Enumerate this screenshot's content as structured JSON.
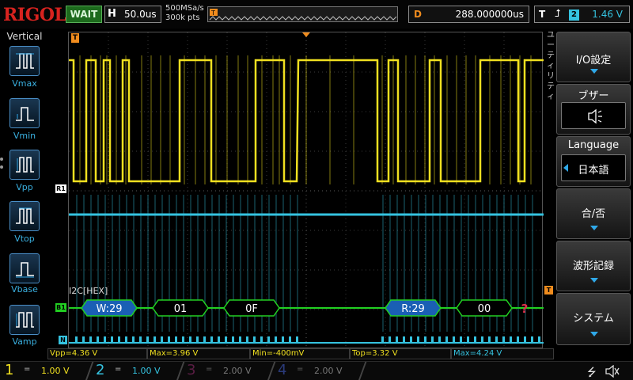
{
  "topbar": {
    "logo": "RIGOL",
    "status": "WAIT",
    "horizontal_key": "H",
    "timebase": "50.0us",
    "sample_rate": "500MSa/s",
    "memory_depth": "300k pts",
    "delay_key": "D",
    "delay": "288.000000us",
    "trigger_key": "T",
    "trigger_source": "2",
    "trigger_level": "1.46 V"
  },
  "sidebar": {
    "title": "Vertical",
    "items": [
      {
        "label": "Vmax"
      },
      {
        "label": "Vmin"
      },
      {
        "label": "Vpp"
      },
      {
        "label": "Vtop"
      },
      {
        "label": "Vbase"
      },
      {
        "label": "Vamp"
      }
    ]
  },
  "markers": {
    "ch1": "R1",
    "bus": "B1",
    "ch2": "N",
    "trigger_top": "T",
    "trigger_right": "T"
  },
  "decoder": {
    "label": "I2C[HEX]",
    "packets": [
      {
        "text": "W:29",
        "kind": "address"
      },
      {
        "text": "01",
        "kind": "data"
      },
      {
        "text": "0F",
        "kind": "data"
      },
      {
        "text": "R:29",
        "kind": "address"
      },
      {
        "text": "00",
        "kind": "data"
      }
    ],
    "error_mark": "?"
  },
  "measurements": [
    "Vpp=4.36 V",
    "Max=3.96 V",
    "Min=-400mV",
    "Top=3.32 V",
    "Max=4.24 V"
  ],
  "menu": {
    "vertical_title": "ユーティリティ",
    "items": [
      {
        "label": "I/O設定"
      },
      {
        "label": "ブザー"
      },
      {
        "label": "Language",
        "value": "日本語"
      },
      {
        "label": "合/否"
      },
      {
        "label": "波形記録"
      },
      {
        "label": "システム"
      }
    ]
  },
  "channels": [
    {
      "num": "1",
      "scale": "1.00 V",
      "color": "#f0e020"
    },
    {
      "num": "2",
      "scale": "1.00 V",
      "color": "#35c3e0"
    },
    {
      "num": "3",
      "scale": "2.00 V",
      "color": "#c02880"
    },
    {
      "num": "4",
      "scale": "2.00 V",
      "color": "#3050c8"
    }
  ],
  "colors": {
    "ch1": "#f0e020",
    "ch2": "#35c3e0",
    "bus": "#22d022",
    "address_packet": "#1a5fb4",
    "accent": "#2fa8e8",
    "trigger": "#f08c1e"
  },
  "icons": {
    "buzzer": "speaker-icon",
    "usb": "usb-icon",
    "speaker": "speaker-icon"
  }
}
